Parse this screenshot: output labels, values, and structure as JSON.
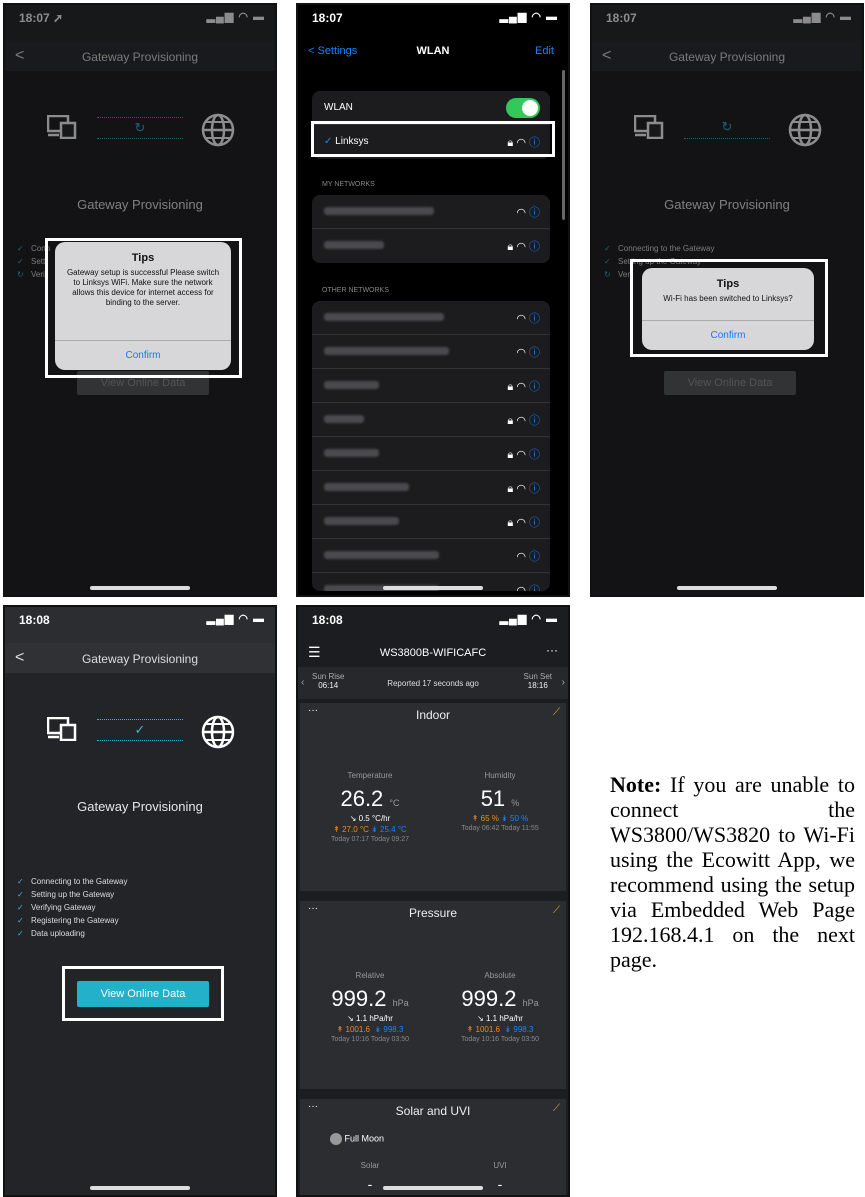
{
  "status": {
    "time1": "18:07 ➚",
    "time2": "18:07",
    "time3": "18:07",
    "time4": "18:08",
    "time5": "18:08",
    "icons": "▂▄▆ ◠ ▬"
  },
  "provisioning": {
    "back": "<",
    "nav_title": "Gateway Provisioning",
    "title": "Gateway Provisioning",
    "steps_full": [
      "Connecting to the Gateway",
      "Setting up the Gateway",
      "Verifying Gateway",
      "Registering the Gateway",
      "Data uploading"
    ],
    "steps_p1": [
      "Conn",
      "Setti",
      "Verif"
    ],
    "steps_p3": [
      "Connecting to the Gateway",
      "Setting up the Gateway",
      "Veri"
    ],
    "view_online": "View Online Data",
    "sync_icon": "↻",
    "check_icon": "✓"
  },
  "dialog1": {
    "title": "Tips",
    "message": "Gateway setup is successful Please switch to Linksys WiFi. Make sure the network allows this device for internet access for binding to the server.",
    "button": "Confirm"
  },
  "dialog2": {
    "title": "Tips",
    "message": "Wi-Fi has been switched to Linksys?",
    "button": "Confirm"
  },
  "wlan": {
    "back": "< Settings",
    "title": "WLAN",
    "edit": "Edit",
    "wlan_label": "WLAN",
    "selected_network": "Linksys",
    "selected_check": "✓",
    "my_networks": "MY NETWORKS",
    "other_networks": "OTHER NETWORKS",
    "info_icon": "ⓘ",
    "wifi_icon": "◠",
    "lock_icon": "🔒"
  },
  "dashboard": {
    "menu": "☰",
    "title": "WS3800B-WIFICAFC",
    "more": "···",
    "sun_rise_label": "Sun Rise",
    "sun_rise_time": "06:14",
    "reported": "Reported 17 seconds ago",
    "sun_set_label": "Sun Set",
    "sun_set_time": "18:16",
    "indoor": {
      "title": "Indoor",
      "temp_label": "Temperature",
      "temp": "26.2",
      "temp_unit": "°C",
      "temp_rate": "↘ 0.5 °C/hr",
      "temp_hi": "↟ 27.0 °C",
      "temp_lo": "↡ 25.4 °C",
      "temp_times": "Today 07:17   Today 09:27",
      "hum_label": "Humidity",
      "hum": "51",
      "hum_unit": "%",
      "hum_hi": "↟ 65 %",
      "hum_lo": "↡ 50 %",
      "hum_times": "Today 06:42   Today 11:55"
    },
    "pressure": {
      "title": "Pressure",
      "rel_label": "Relative",
      "rel": "999.2",
      "unit": "hPa",
      "rel_rate": "↘ 1.1 hPa/hr",
      "rel_hi": "↟ 1001.6",
      "rel_lo": "↡ 998.3",
      "rel_times": "Today 10:16   Today 03:50",
      "abs_label": "Absolute",
      "abs": "999.2",
      "abs_rate": "↘ 1.1 hPa/hr",
      "abs_hi": "↟ 1001.6",
      "abs_lo": "↡ 998.3",
      "abs_times": "Today 10:16   Today 03:50"
    },
    "solar": {
      "title": "Solar and UVI",
      "moon": "Full Moon",
      "solar_label": "Solar",
      "solar_val": "-",
      "uvi_label": "UVI",
      "uvi_val": "-"
    },
    "card_dots": "···",
    "graph_icon": "⟋"
  },
  "note": {
    "bold": "Note:",
    "text": " If you are unable to connect the WS3800/WS3820 to Wi-Fi using the Ecowitt App, we recommend using the setup via Embedded Web Page 192.168.4.1 on the next page."
  },
  "colors": {
    "accent": "#3bb7d0",
    "ios_blue": "#1a84ff",
    "toggle_green": "#34c759"
  }
}
